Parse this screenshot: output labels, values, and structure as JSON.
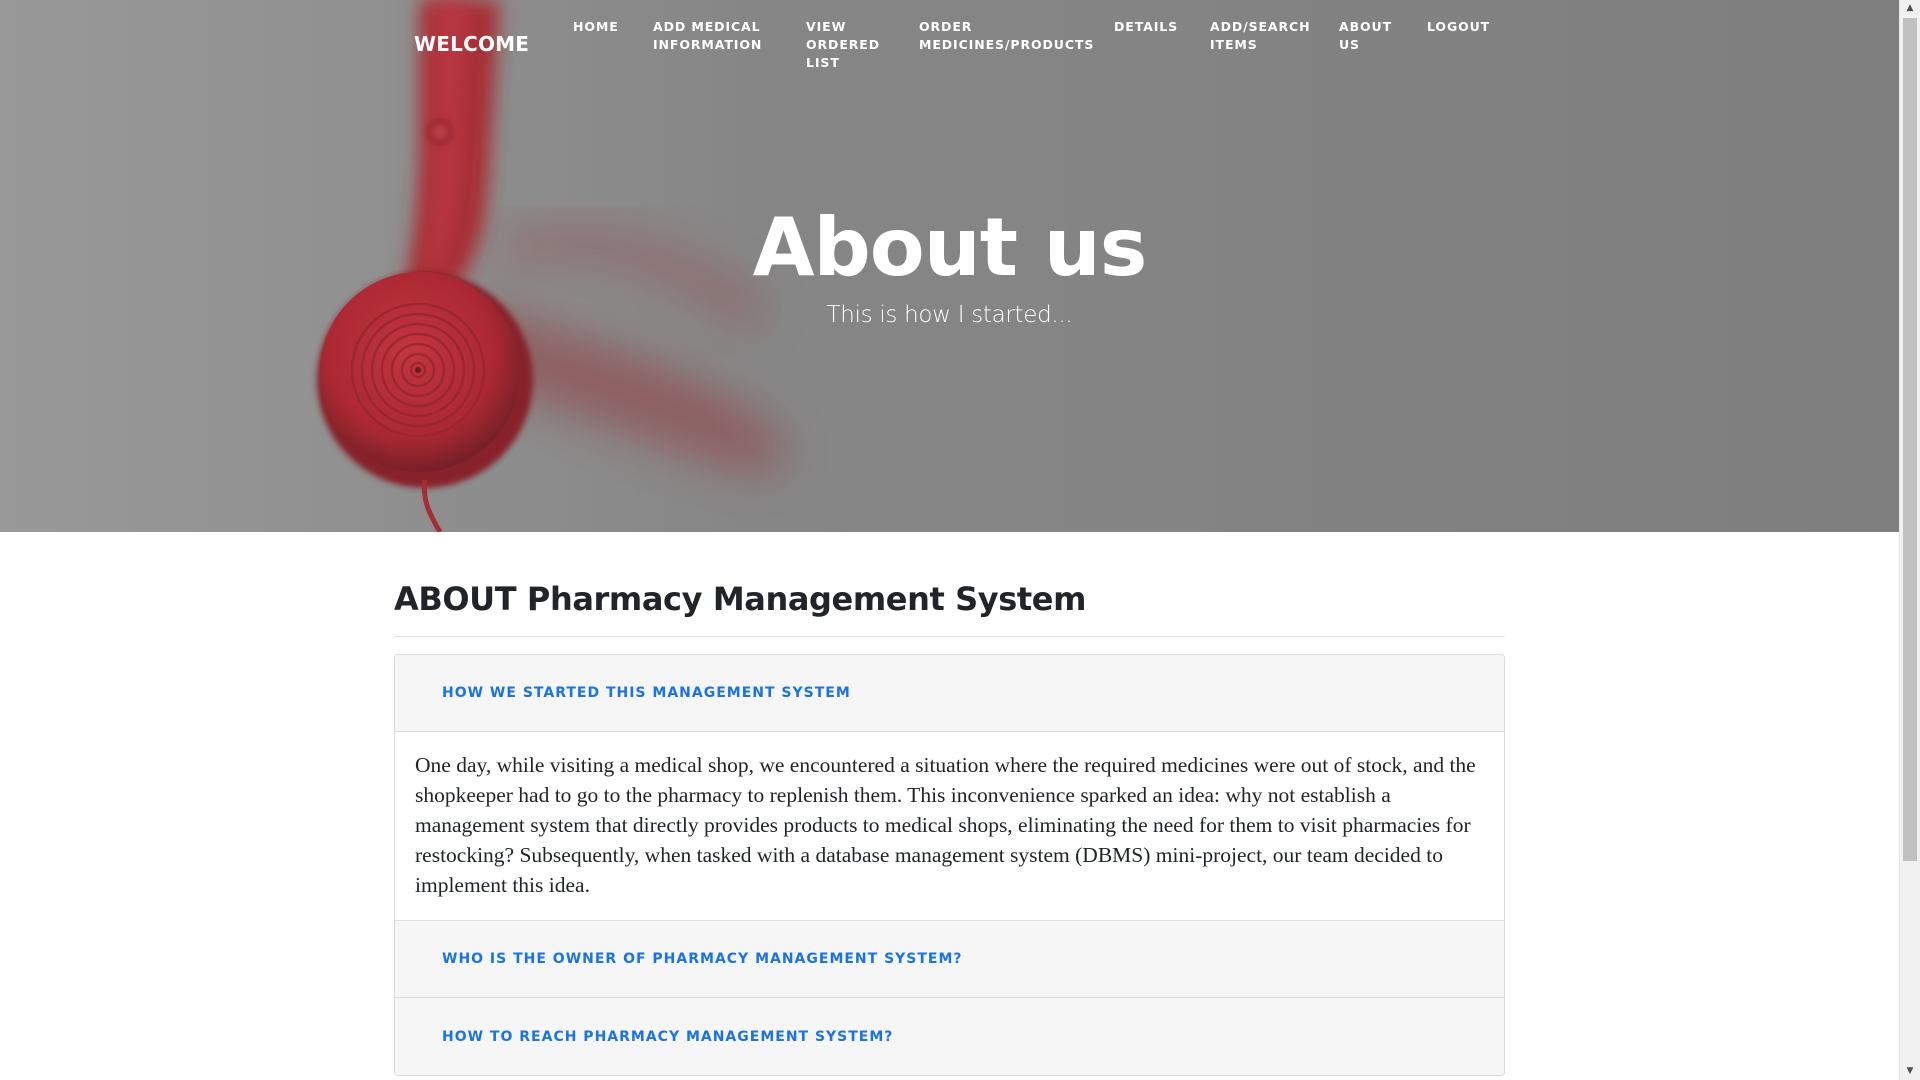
{
  "brand": "WELCOME",
  "nav": {
    "items": [
      {
        "line1": "HOME",
        "line2": "",
        "line3": ""
      },
      {
        "line1": "ADD MEDICAL",
        "line2": "INFORMATION",
        "line3": ""
      },
      {
        "line1": "VIEW",
        "line2": "ORDERED",
        "line3": "LIST"
      },
      {
        "line1": "ORDER",
        "line2": "MEDICINES/PRODUCTS",
        "line3": ""
      },
      {
        "line1": "DETAILS",
        "line2": "",
        "line3": ""
      },
      {
        "line1": "ADD/SEARCH",
        "line2": "ITEMS",
        "line3": ""
      },
      {
        "line1": "ABOUT",
        "line2": "US",
        "line3": ""
      },
      {
        "line1": "LOGOUT",
        "line2": "",
        "line3": ""
      }
    ]
  },
  "hero": {
    "title": "About us",
    "subtitle": "This is how I started..."
  },
  "about": {
    "title": "ABOUT Pharmacy Management System",
    "accordion": [
      {
        "label": "HOW WE STARTED THIS MANAGEMENT SYSTEM",
        "body": "One day, while visiting a medical shop, we encountered a situation where the required medicines were out of stock, and the shopkeeper had to go to the pharmacy to replenish them. This inconvenience sparked an idea: why not establish a management system that directly provides products to medical shops, eliminating the need for them to visit pharmacies for restocking? Subsequently, when tasked with a database management system (DBMS) mini-project, our team decided to implement this idea."
      },
      {
        "label": "WHO IS THE OWNER OF PHARMACY MANAGEMENT SYSTEM?"
      },
      {
        "label": "HOW TO REACH PHARMACY MANAGEMENT SYSTEM?"
      }
    ]
  },
  "colors": {
    "accent": "#1a73e8",
    "hero_gray": "#8c8c8c",
    "phone_red": "#c62a35"
  },
  "icons": {
    "scroll_up": "triangle-up",
    "scroll_down": "triangle-down"
  }
}
